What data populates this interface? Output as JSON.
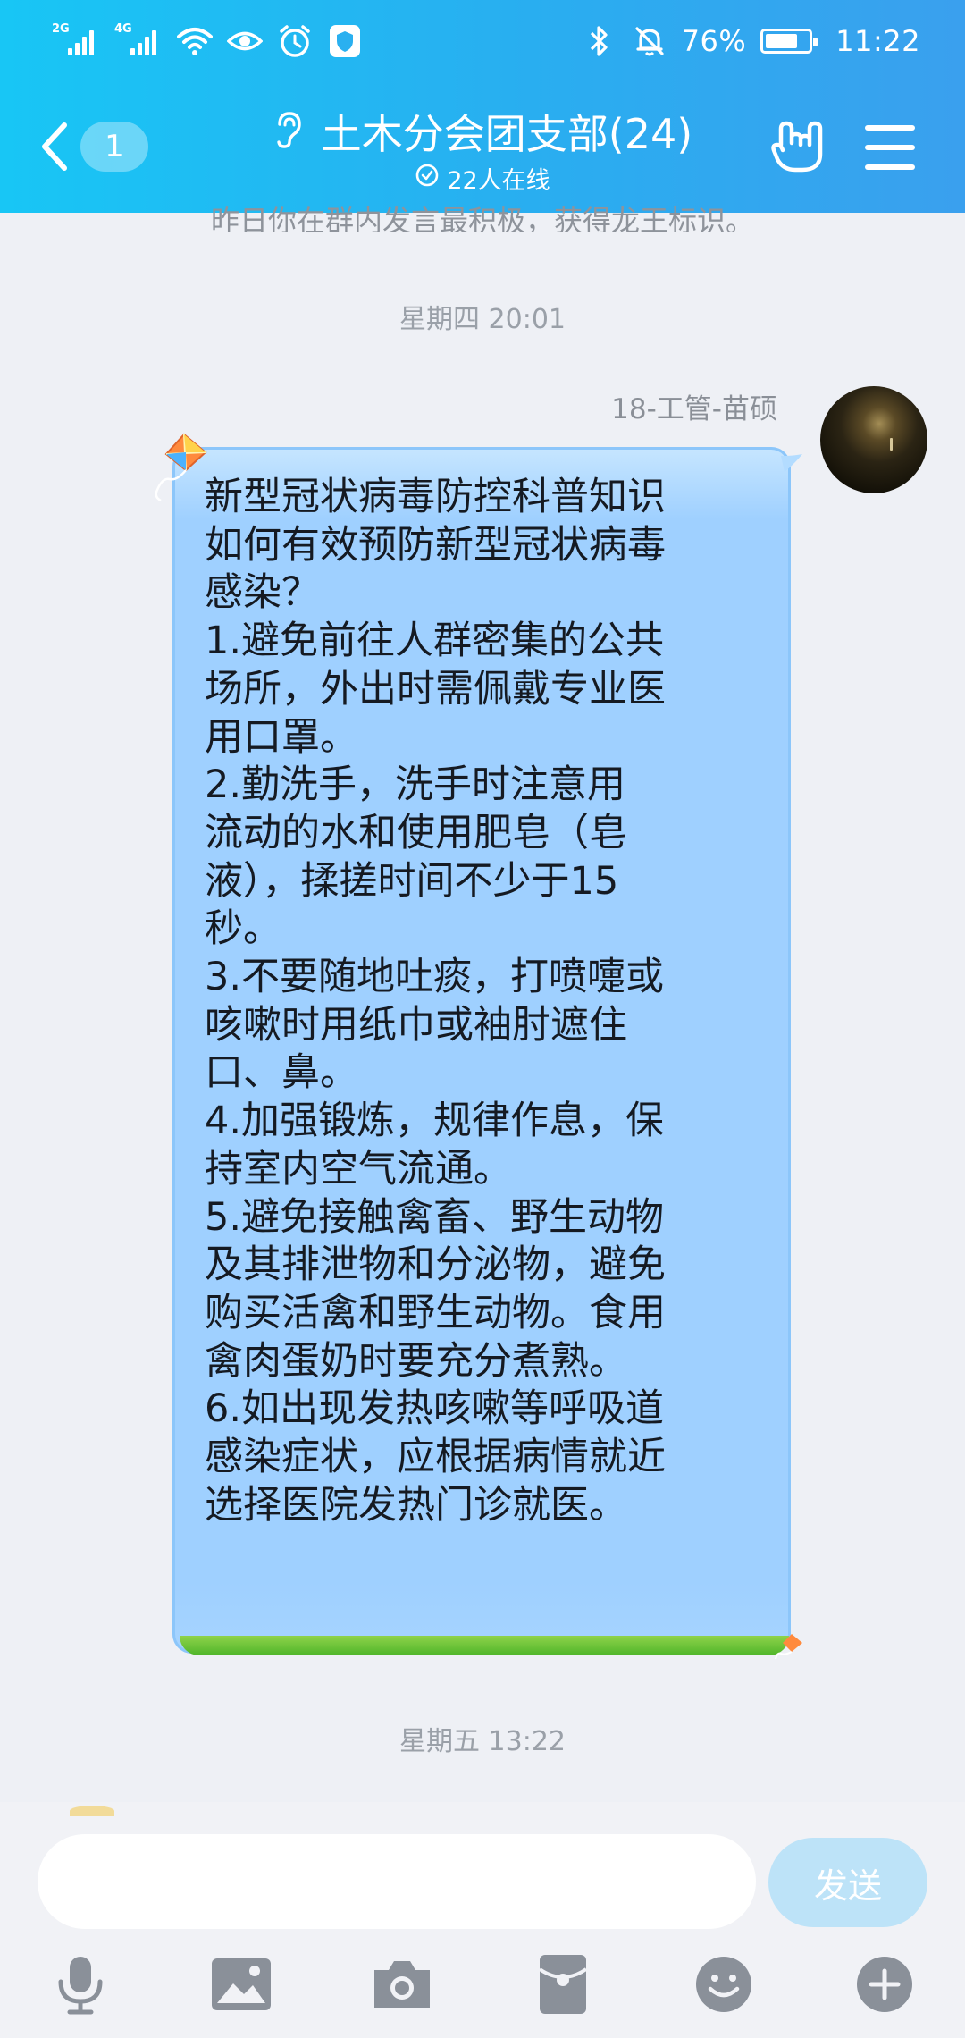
{
  "status_bar": {
    "sim1_network": "2G",
    "sim2_network": "4G",
    "icons": [
      "signal-icon",
      "wifi-icon",
      "eye-comfort-icon",
      "alarm-icon",
      "shield-icon",
      "bluetooth-icon",
      "mute-icon"
    ],
    "battery_percent_text": "76%",
    "battery_level": 0.76,
    "time": "11:22"
  },
  "header": {
    "unread_count": "1",
    "title": "土木分会团支部(24)",
    "online_text": "22人在线",
    "colors": {
      "gradient_start": "#18c6f5",
      "gradient_end": "#3aa0ee"
    }
  },
  "chat": {
    "partial_notice": "昨日你在群内发言最积极，获得龙王标识。",
    "timestamp_1": "星期四 20:01",
    "message": {
      "sender": "18-工管-苗硕",
      "lines": [
        "新型冠状病毒防控科普知识",
        "如何有效预防新型冠状病毒",
        "感染？",
        "1.避免前往人群密集的公共",
        "场所，外出时需佩戴专业医",
        "用口罩。",
        "2.勤洗手，洗手时注意用",
        "流动的水和使用肥皂（皂",
        "液），揉搓时间不少于15",
        "秒。",
        "3.不要随地吐痰，打喷嚏或",
        "咳嗽时用纸巾或袖肘遮住",
        "口、鼻。",
        "4.加强锻炼，规律作息，保",
        "持室内空气流通。",
        "5.避免接触禽畜、野生动物",
        "及其排泄物和分泌物，避免",
        "购买活禽和野生动物。食用",
        "禽肉蛋奶时要充分煮熟。",
        "6.如出现发热咳嗽等呼吸道",
        "感染症状，应根据病情就近",
        "选择医院发热门诊就医。"
      ],
      "bubble_color": "#9fd0ff"
    },
    "timestamp_2": "星期五 13:22"
  },
  "input": {
    "placeholder": "",
    "send_label": "发送"
  },
  "toolbar": {
    "icons": [
      "microphone-icon",
      "image-icon",
      "camera-icon",
      "red-packet-icon",
      "emoji-icon",
      "plus-icon"
    ]
  }
}
